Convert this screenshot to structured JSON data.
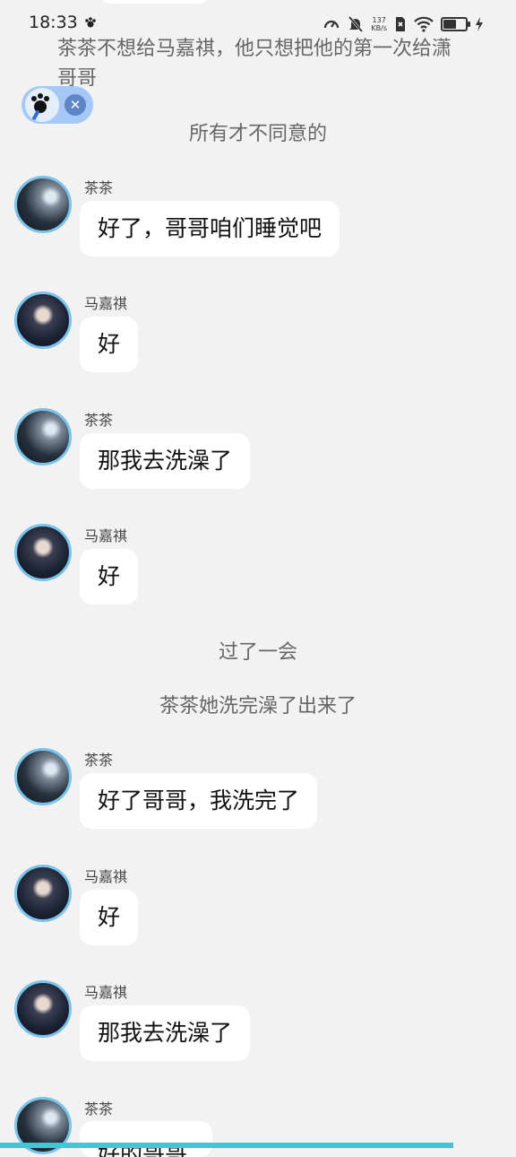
{
  "status_bar": {
    "time": "18:33",
    "net_speed_value": "137",
    "net_speed_unit": "KB/s",
    "battery_level": 0.7
  },
  "narration_top": "茶茶不想给马嘉祺，他只想把他的第一次给潇哥哥",
  "narration_1": "所有才不同意的",
  "narration_2": "过了一会",
  "narration_3": "茶茶她洗完澡了出来了",
  "messages": [
    {
      "sender": "茶茶",
      "text": "好了，哥哥咱们睡觉吧"
    },
    {
      "sender": "马嘉祺",
      "text": "好"
    },
    {
      "sender": "茶茶",
      "text": "那我去洗澡了"
    },
    {
      "sender": "马嘉祺",
      "text": "好"
    },
    {
      "sender": "茶茶",
      "text": "好了哥哥，我洗完了"
    },
    {
      "sender": "马嘉祺",
      "text": "好"
    },
    {
      "sender": "马嘉祺",
      "text": "那我去洗澡了"
    },
    {
      "sender": "茶茶",
      "text": "好的哥哥"
    }
  ],
  "colors": {
    "background": "#f2f2f2",
    "avatar_ring": "#7cc3ea",
    "bottom_bar": "#3ec8d6",
    "pill": "#a6c8f4"
  },
  "icons": [
    "paw-icon",
    "speedometer-icon",
    "mute-bell-icon",
    "sim-off-icon",
    "wifi-icon",
    "battery-icon",
    "charging-bolt-icon",
    "close-icon"
  ]
}
